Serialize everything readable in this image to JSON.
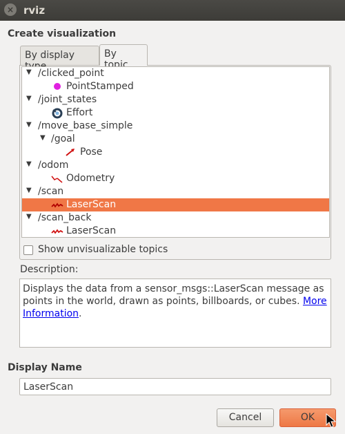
{
  "window": {
    "title": "rviz",
    "close_glyph": "×"
  },
  "section_title": "Create visualization",
  "tabs": [
    {
      "label": "By display type",
      "active": false
    },
    {
      "label": "By topic",
      "active": true
    }
  ],
  "tree": {
    "rows": [
      {
        "text": "/clicked_point",
        "expanded": true
      },
      {
        "text": "PointStamped",
        "icon": "point-icon"
      },
      {
        "text": "/joint_states",
        "expanded": true
      },
      {
        "text": "Effort",
        "icon": "effort-icon"
      },
      {
        "text": "/move_base_simple",
        "expanded": true
      },
      {
        "text": "/goal",
        "expanded": true
      },
      {
        "text": "Pose",
        "icon": "pose-arrow-icon"
      },
      {
        "text": "/odom",
        "expanded": true
      },
      {
        "text": "Odometry",
        "icon": "odometry-icon"
      },
      {
        "text": "/scan",
        "expanded": true
      },
      {
        "text": "LaserScan",
        "icon": "laserscan-icon",
        "selected": true
      },
      {
        "text": "/scan_back",
        "expanded": true
      },
      {
        "text": "LaserScan",
        "icon": "laserscan-icon"
      }
    ],
    "expand_glyph": "▼"
  },
  "show_unvisualizable": {
    "label": "Show unvisualizable topics",
    "checked": false
  },
  "description": {
    "label": "Description:",
    "text": "Displays the data from a sensor_msgs::LaserScan message as points in the world, drawn as points, billboards, or cubes. ",
    "link_text": "More Information",
    "trailing": "."
  },
  "display_name": {
    "label": "Display Name",
    "value": "LaserScan"
  },
  "buttons": {
    "cancel": "Cancel",
    "ok": "OK"
  },
  "colors": {
    "accent": "#f07746",
    "titlebar": "#3d3c38",
    "point_icon": "#e020e0",
    "icon_red": "#d01010"
  }
}
